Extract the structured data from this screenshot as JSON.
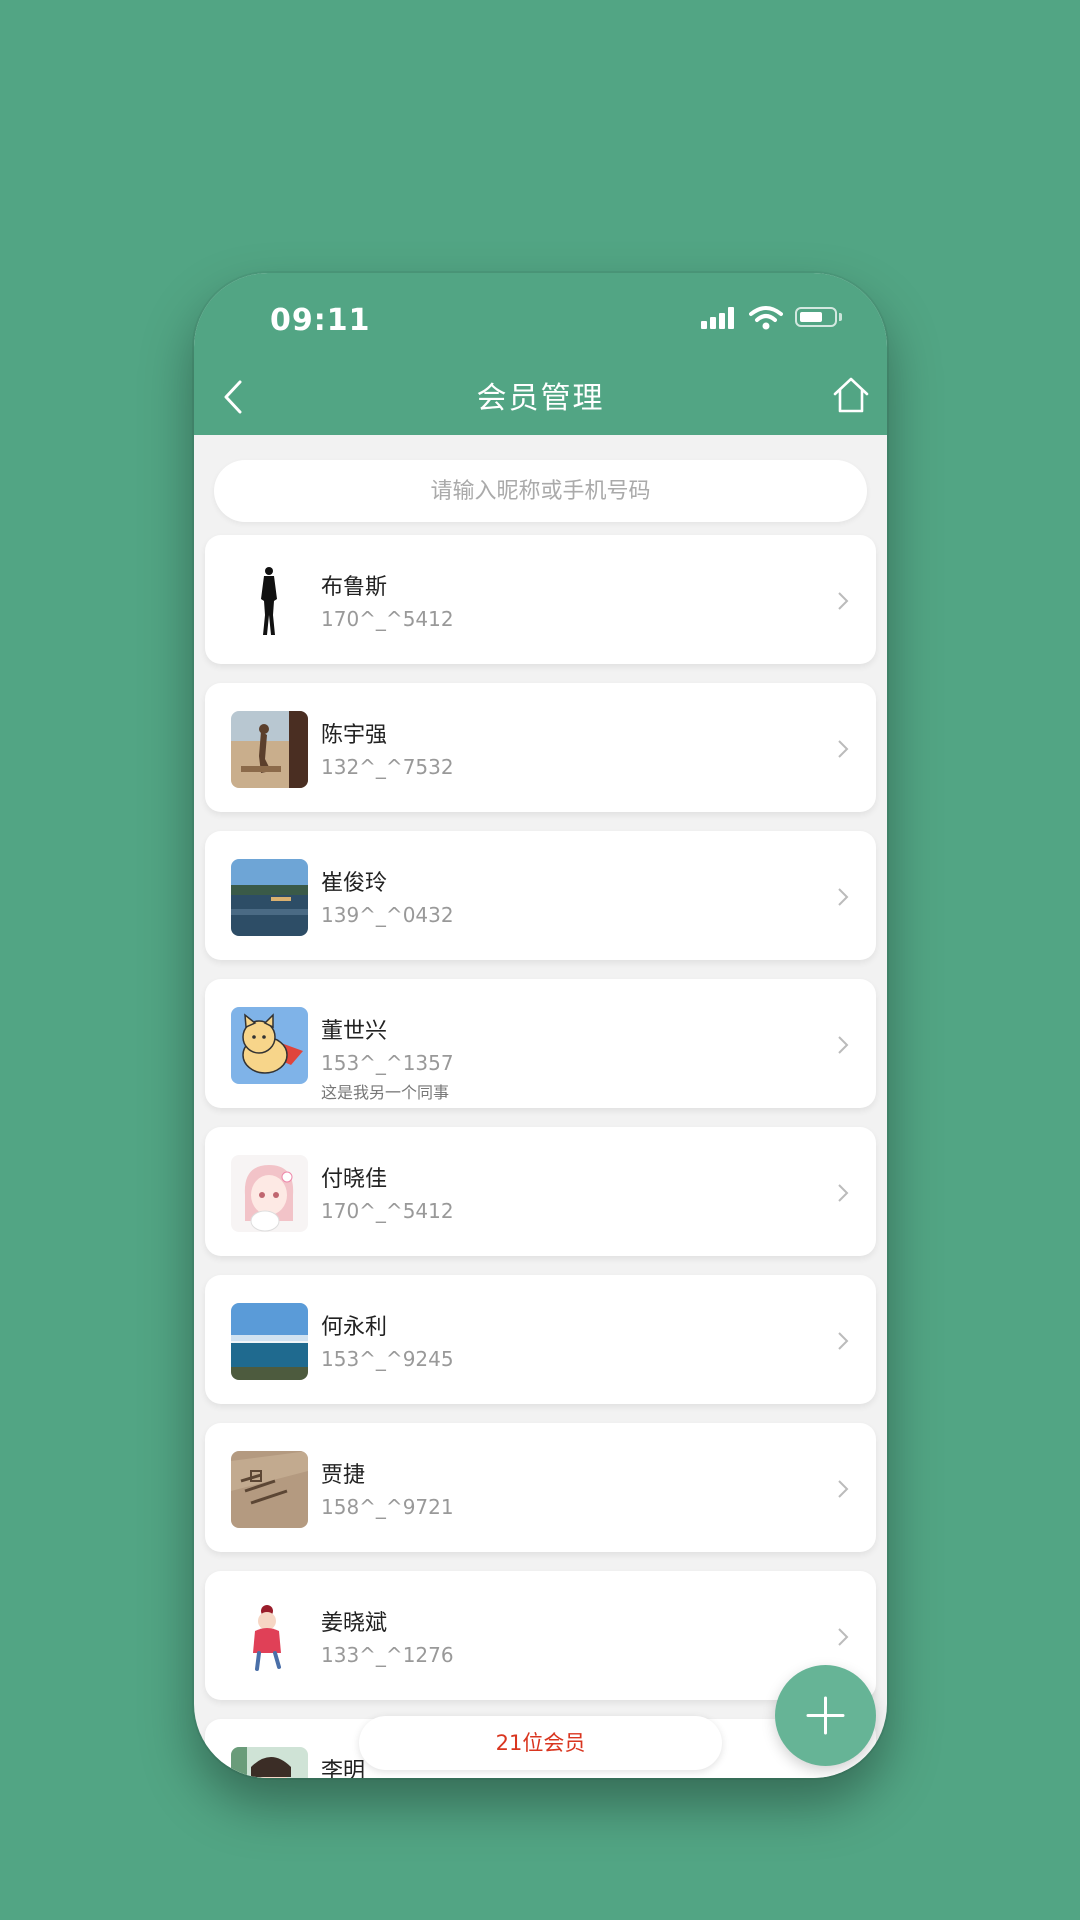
{
  "status_bar": {
    "time": "09:11"
  },
  "header": {
    "title": "会员管理",
    "back_icon": "chevron-left-icon",
    "home_icon": "home-icon"
  },
  "search": {
    "placeholder": "请输入昵称或手机号码"
  },
  "members": [
    {
      "name": "布鲁斯",
      "phone": "170^_^5412",
      "note": "",
      "avatar": "silhouette"
    },
    {
      "name": "陈宇强",
      "phone": "132^_^7532",
      "note": "",
      "avatar": "beach-statue"
    },
    {
      "name": "崔俊玲",
      "phone": "139^_^0432",
      "note": "",
      "avatar": "lake"
    },
    {
      "name": "董世兴",
      "phone": "153^_^1357",
      "note": "这是我另一个同事",
      "avatar": "cartoon-cat"
    },
    {
      "name": "付晓佳",
      "phone": "170^_^5412",
      "note": "",
      "avatar": "anime-girl"
    },
    {
      "name": "何永利",
      "phone": "153^_^9245",
      "note": "",
      "avatar": "sea"
    },
    {
      "name": "贾捷",
      "phone": "158^_^9721",
      "note": "",
      "avatar": "engraving"
    },
    {
      "name": "姜晓斌",
      "phone": "133^_^1276",
      "note": "",
      "avatar": "cartoon-girl"
    },
    {
      "name": "李明",
      "phone": "",
      "note": "",
      "avatar": "photo"
    }
  ],
  "footer": {
    "count_label": "21位会员",
    "add_icon": "plus-icon"
  },
  "colors": {
    "brand": "#52a584",
    "count_text": "#d9351f",
    "fab": "#66b496"
  }
}
